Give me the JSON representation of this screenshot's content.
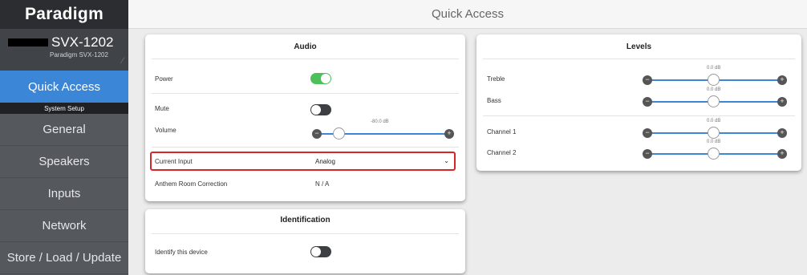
{
  "sidebar": {
    "brand": "Paradigm",
    "device_name": "SVX-1202",
    "device_subtitle": "Paradigm SVX-1202",
    "active_item": "Quick Access",
    "section_header": "System Setup",
    "items": [
      {
        "label": "General"
      },
      {
        "label": "Speakers"
      },
      {
        "label": "Inputs"
      },
      {
        "label": "Network"
      },
      {
        "label": "Store / Load / Update"
      }
    ]
  },
  "header": {
    "title": "Quick Access"
  },
  "audio": {
    "title": "Audio",
    "power_label": "Power",
    "power_on": true,
    "mute_label": "Mute",
    "mute_on": false,
    "volume_label": "Volume",
    "volume_value": "-80.0 dB",
    "volume_fraction": 0.18,
    "input_label": "Current Input",
    "input_value": "Analog",
    "room_correction_label": "Anthem Room Correction",
    "room_correction_value": "N / A"
  },
  "identification": {
    "title": "Identification",
    "identify_label": "Identify this device",
    "identify_on": false
  },
  "levels": {
    "title": "Levels",
    "treble_label": "Treble",
    "treble_value": "0.0 dB",
    "bass_label": "Bass",
    "bass_value": "0.0 dB",
    "ch1_label": "Channel 1",
    "ch1_value": "0.0 dB",
    "ch2_label": "Channel 2",
    "ch2_value": "0.0 dB"
  },
  "colors": {
    "accent": "#3c86d8",
    "toggle_on": "#4cc05a",
    "highlight": "#d8252a"
  }
}
